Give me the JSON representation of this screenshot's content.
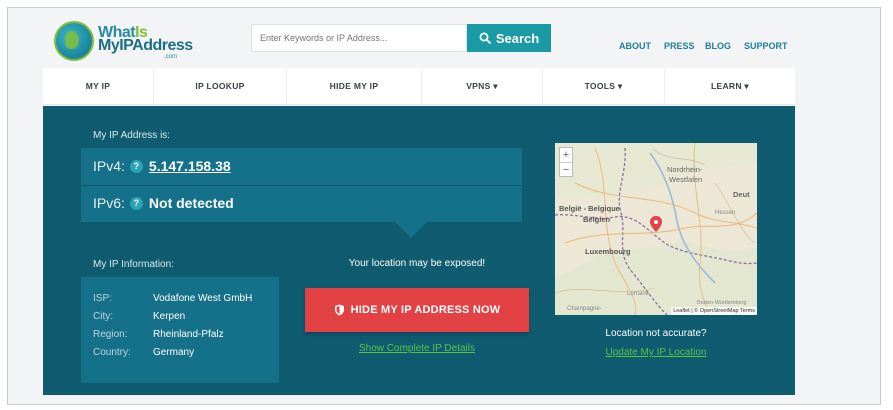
{
  "logo": {
    "line1_a": "What",
    "line1_b": "Is",
    "line2": "MyIPAddress",
    "line3": ".com"
  },
  "search": {
    "placeholder": "Enter Keywords or IP Address...",
    "button_label": "Search"
  },
  "top_links": [
    "ABOUT",
    "PRESS",
    "BLOG",
    "SUPPORT"
  ],
  "nav": [
    {
      "label": "MY IP"
    },
    {
      "label": "IP LOOKUP"
    },
    {
      "label": "HIDE MY IP"
    },
    {
      "label": "VPNS ▾"
    },
    {
      "label": "TOOLS ▾"
    },
    {
      "label": "LEARN ▾"
    }
  ],
  "ip": {
    "heading": "My IP Address is:",
    "ipv4_label": "IPv4:",
    "ipv4_value": "5.147.158.38",
    "ipv6_label": "IPv6:",
    "ipv6_value": "Not detected",
    "help_glyph": "?"
  },
  "info": {
    "heading": "My IP Information:",
    "rows": [
      {
        "label": "ISP:",
        "value": "Vodafone West GmbH"
      },
      {
        "label": "City:",
        "value": "Kerpen"
      },
      {
        "label": "Region:",
        "value": "Rheinland-Pfalz"
      },
      {
        "label": "Country:",
        "value": "Germany"
      }
    ]
  },
  "warning": {
    "exposed_text": "Your location may be exposed!",
    "hide_button_label": "HIDE MY IP ADDRESS NOW",
    "details_link": "Show Complete IP Details"
  },
  "map": {
    "zoom_in": "+",
    "zoom_out": "−",
    "attribution": "Leaflet | © OpenStreetMap Terms",
    "labels": {
      "nordrhein": "Nordrhein-",
      "westfalen": "Westfalen",
      "belgie": "België - Belgique",
      "belgien": "Belgien",
      "luxembourg": "Luxembourg",
      "deut": "Deut",
      "hessen": "Hessen",
      "lorraine": "Lorraine",
      "champagne": "Champagne-",
      "baden": "Baden-Württemberg"
    },
    "not_accurate": "Location not accurate?",
    "update_link": "Update My IP Location"
  },
  "colors": {
    "panel": "#0f5b70",
    "box": "#15708a",
    "search_btn": "#1a9aa4",
    "hide_btn": "#e24244",
    "link_green": "#57c54a"
  }
}
